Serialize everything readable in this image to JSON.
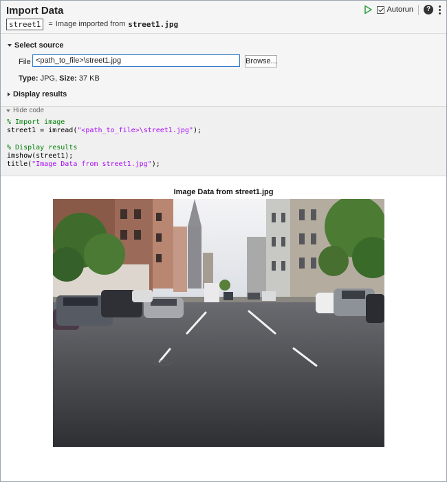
{
  "task": {
    "title": "Import Data",
    "variable": "street1",
    "equals": "=",
    "summary_text": "Image imported from",
    "summary_file": "street1.jpg",
    "autorun_label": "Autorun",
    "help_glyph": "?",
    "icons": [
      "run-icon",
      "checkbox-icon",
      "help-icon",
      "more-options-icon"
    ],
    "accent_color": "#2ea043"
  },
  "select_source": {
    "heading": "Select source",
    "file_label": "File",
    "file_value": "<path_to_file>\\street1.jpg",
    "browse_label": "Browse...",
    "type_label": "Type:",
    "type_value": "JPG,",
    "size_label": "Size:",
    "size_value": "37 KB"
  },
  "display_results": {
    "heading": "Display results"
  },
  "code": {
    "toggle_label": "Hide code",
    "lines": [
      {
        "comment": "% Import image"
      },
      {
        "pre": "street1 = imread(",
        "str": "\"<path_to_file>\\street1.jpg\"",
        "post": ");"
      },
      {
        "blank": ""
      },
      {
        "comment": "% Display results"
      },
      {
        "pre": "imshow(street1);"
      },
      {
        "pre": "title(",
        "str": "\"Image Data from street1.jpg\"",
        "post": ");"
      }
    ]
  },
  "figure": {
    "title": "Image Data from street1.jpg"
  }
}
